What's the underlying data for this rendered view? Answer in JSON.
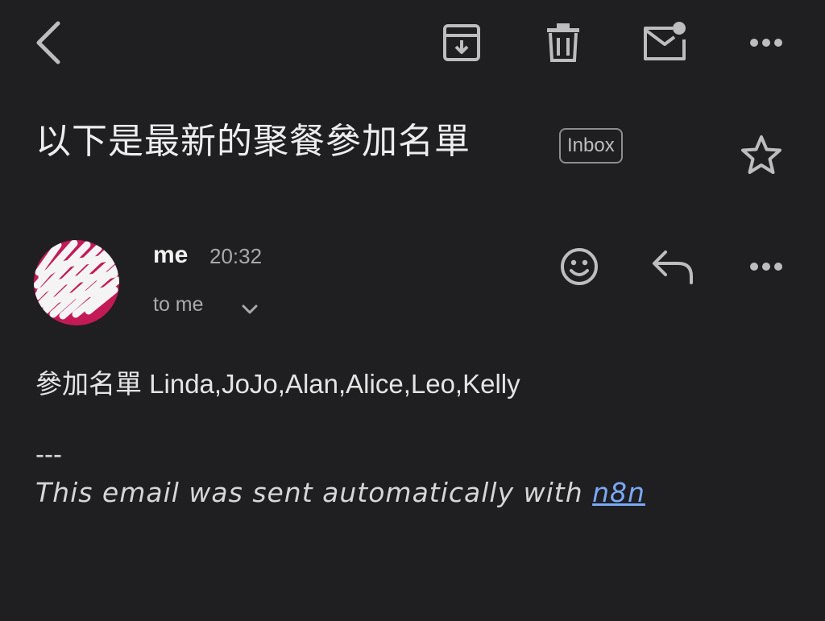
{
  "header": {
    "icons": [
      "back-icon",
      "archive-icon",
      "trash-icon",
      "mark-unread-icon",
      "more-icon"
    ]
  },
  "email": {
    "subject": "以下是最新的聚餐參加名單",
    "label": "Inbox",
    "sender": "me",
    "time": "20:32",
    "recipients": "to me",
    "body": "參加名單 Linda,JoJo,Alan,Alice,Leo,Kelly",
    "signature_separator": "---",
    "signature_text": "This email was sent automatically with ",
    "signature_link": "n8n"
  },
  "colors": {
    "background": "#1f1f22",
    "avatar": "#c21a55",
    "link": "#7aa9f5"
  }
}
